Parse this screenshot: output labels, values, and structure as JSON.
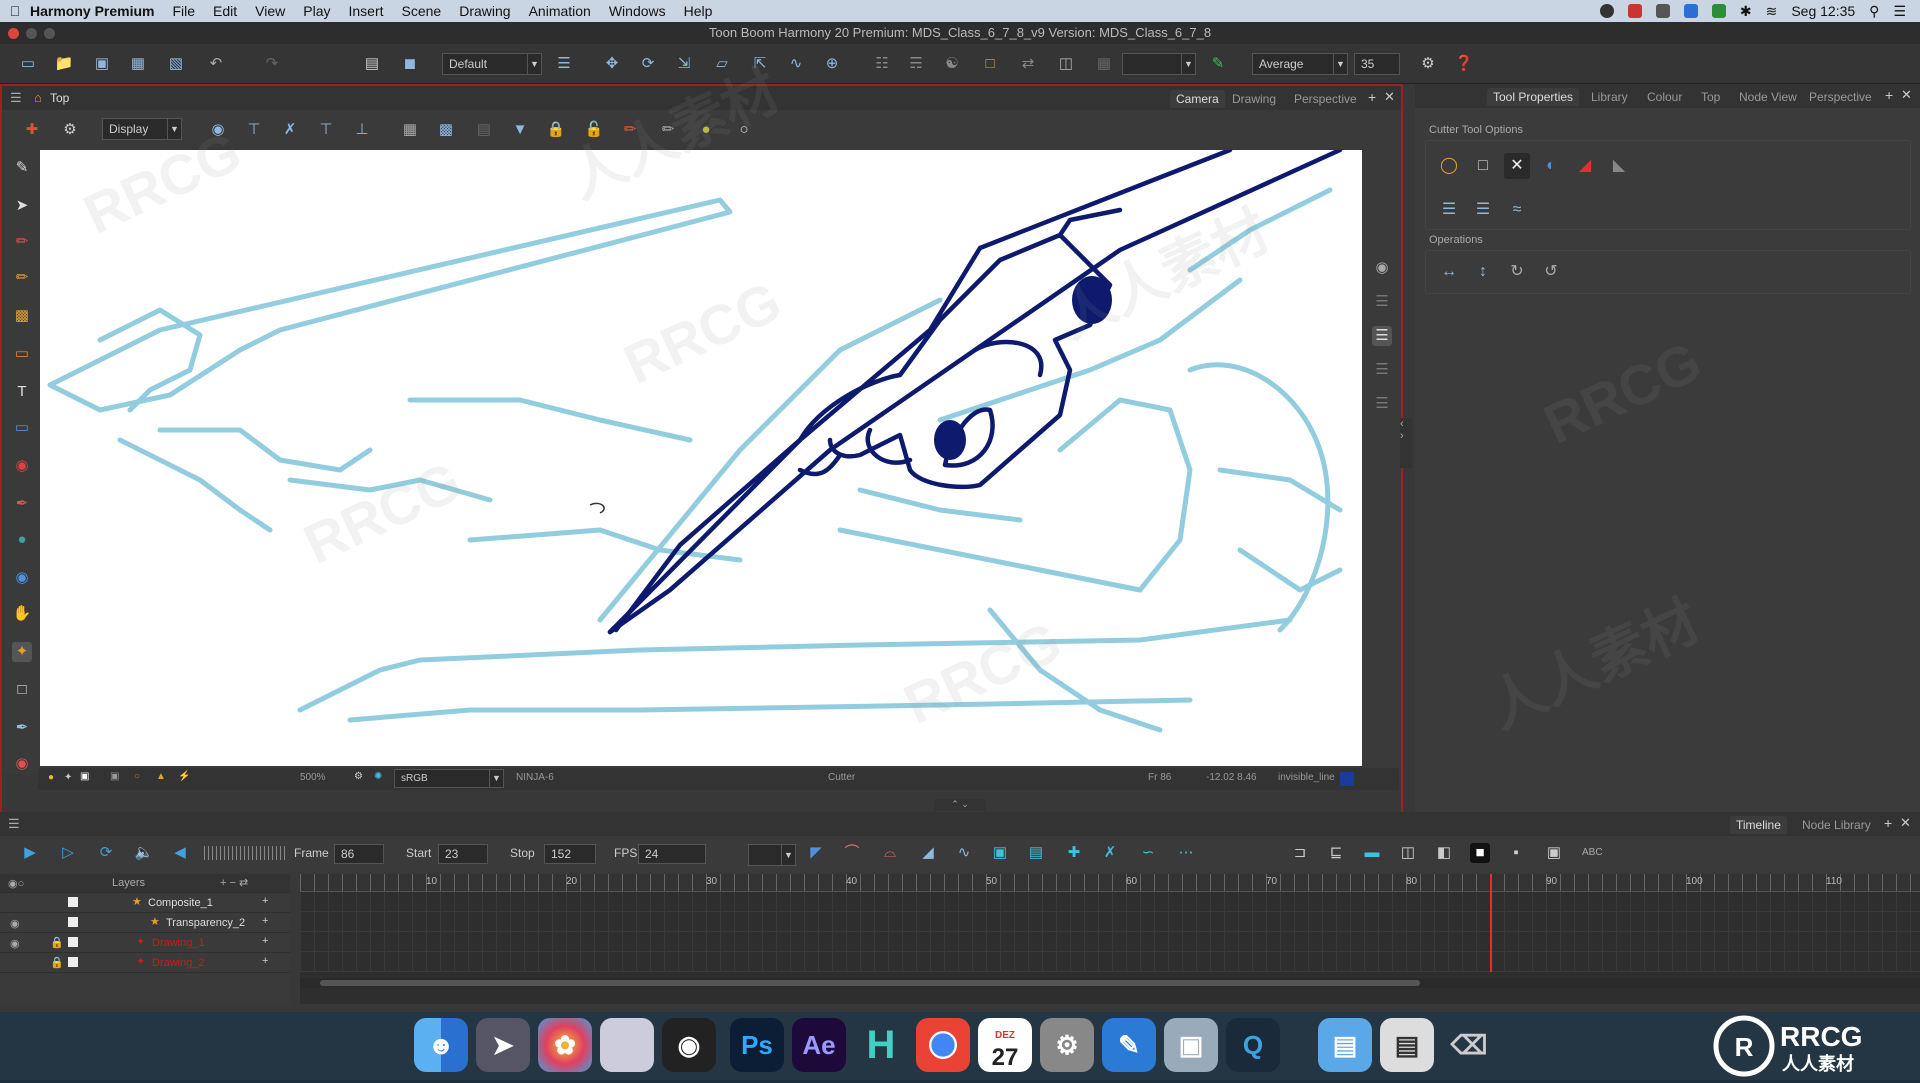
{
  "menubar": {
    "app_name": "Harmony Premium",
    "items": [
      "File",
      "Edit",
      "View",
      "Play",
      "Insert",
      "Scene",
      "Drawing",
      "Animation",
      "Windows",
      "Help"
    ],
    "clock": "Seg 12:35"
  },
  "window": {
    "title": "Toon Boom Harmony 20 Premium: MDS_Class_6_7_8_v9 Version: MDS_Class_6_7_8"
  },
  "top_toolbar": {
    "workspace_value": "Default",
    "smoothing_value": "Average",
    "smoothing_amount": "35"
  },
  "camera_view": {
    "view_label": "Top",
    "tabs": [
      "Camera",
      "Drawing",
      "Perspective"
    ],
    "active_tab": "Camera",
    "display_value": "Display",
    "status": {
      "zoom": "500%",
      "color_space": "sRGB",
      "drawing_name": "NINJA-6",
      "tool_name": "Cutter",
      "frame": "Fr 86",
      "coords": "-12.02 8.46",
      "palette_color": "invisible_line"
    }
  },
  "tool_properties": {
    "tabs": [
      "Tool Properties",
      "Library",
      "Colour",
      "Top",
      "Node View",
      "Perspective"
    ],
    "active_tab": "Tool Properties",
    "section_title": "Cutter Tool Options",
    "operations_title": "Operations"
  },
  "timeline": {
    "tabs": [
      "Timeline",
      "Node Library"
    ],
    "frame_label": "Frame",
    "frame_value": "86",
    "start_label": "Start",
    "start_value": "23",
    "stop_label": "Stop",
    "stop_value": "152",
    "fps_label": "FPS",
    "fps_value": "24",
    "layers_header": "Layers",
    "layers": [
      {
        "name": "Composite_1",
        "color": "#dddddd"
      },
      {
        "name": "Transparency_2",
        "color": "#dddddd"
      },
      {
        "name": "Drawing_1",
        "color": "#c02020"
      },
      {
        "name": "Drawing_2",
        "color": "#c02020"
      }
    ],
    "ruler_marks": [
      "10",
      "20",
      "30",
      "40",
      "50",
      "60",
      "70",
      "80",
      "90",
      "100",
      "110"
    ],
    "current_frame": 86
  },
  "dock": {
    "apps": [
      "finder-icon",
      "launchpad-icon",
      "photos-icon",
      "pixelmator-icon",
      "davinci-icon",
      "Ps",
      "Ae",
      "H",
      "chrome-icon",
      "27",
      "settings-icon",
      "notes-icon",
      "preview-icon",
      "quicktime-icon",
      "folder-icon",
      "harmony-doc-icon",
      "trash-icon"
    ],
    "calendar_month": "DEZ",
    "calendar_day": "27"
  },
  "watermark": {
    "text_latin": "RRCG",
    "text_cn": "人人素材"
  },
  "colors": {
    "accent_red": "#a02020",
    "ink_blue": "#0d1a6e",
    "sketch_blue": "#7fc4da"
  }
}
